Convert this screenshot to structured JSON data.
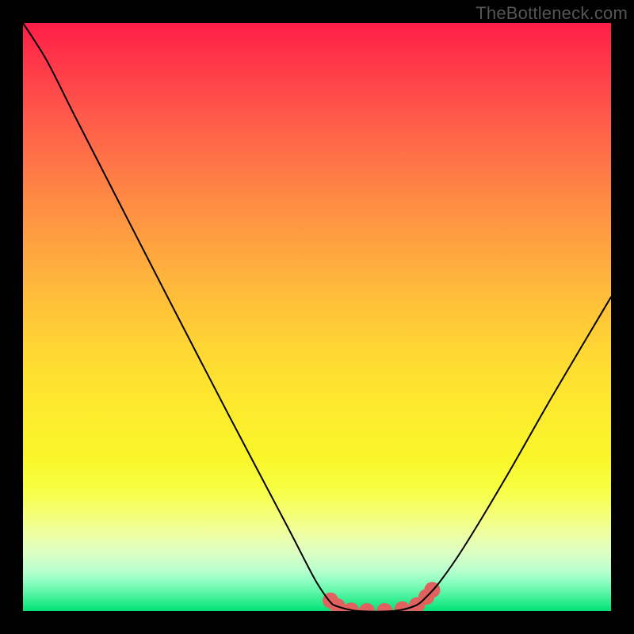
{
  "watermark": "TheBottleneck.com",
  "chart_data": {
    "type": "line",
    "title": "",
    "xlabel": "",
    "ylabel": "",
    "xlim": [
      0,
      100
    ],
    "ylim": [
      0,
      100
    ],
    "grid": false,
    "background": "red-yellow-green vertical gradient",
    "series": [
      {
        "name": "bottleneck-curve",
        "color": "#000000",
        "stroke_width": 2,
        "points": [
          {
            "x": 0.0,
            "y": 100.0
          },
          {
            "x": 4.0,
            "y": 93.7
          },
          {
            "x": 8.6,
            "y": 84.6
          },
          {
            "x": 15.0,
            "y": 72.1
          },
          {
            "x": 25.0,
            "y": 52.6
          },
          {
            "x": 35.0,
            "y": 33.3
          },
          {
            "x": 45.0,
            "y": 14.3
          },
          {
            "x": 48.3,
            "y": 7.9
          },
          {
            "x": 50.1,
            "y": 4.6
          },
          {
            "x": 52.2,
            "y": 1.6
          },
          {
            "x": 53.4,
            "y": 0.8
          },
          {
            "x": 57.0,
            "y": 0.0
          },
          {
            "x": 63.0,
            "y": 0.0
          },
          {
            "x": 66.7,
            "y": 0.9
          },
          {
            "x": 68.6,
            "y": 2.4
          },
          {
            "x": 71.0,
            "y": 5.1
          },
          {
            "x": 75.0,
            "y": 10.9
          },
          {
            "x": 82.0,
            "y": 22.5
          },
          {
            "x": 90.0,
            "y": 36.5
          },
          {
            "x": 100.0,
            "y": 53.4
          }
        ]
      },
      {
        "name": "floor-markers",
        "color": "#e0615e",
        "marker": "circle",
        "marker_radius": 10,
        "points": [
          {
            "x": 52.3,
            "y": 1.8
          },
          {
            "x": 53.5,
            "y": 0.8
          },
          {
            "x": 55.8,
            "y": 0.1
          },
          {
            "x": 58.5,
            "y": 0.0
          },
          {
            "x": 61.5,
            "y": 0.0
          },
          {
            "x": 64.5,
            "y": 0.3
          },
          {
            "x": 67.0,
            "y": 1.0
          },
          {
            "x": 68.6,
            "y": 2.4
          },
          {
            "x": 69.6,
            "y": 3.6
          }
        ]
      }
    ]
  }
}
